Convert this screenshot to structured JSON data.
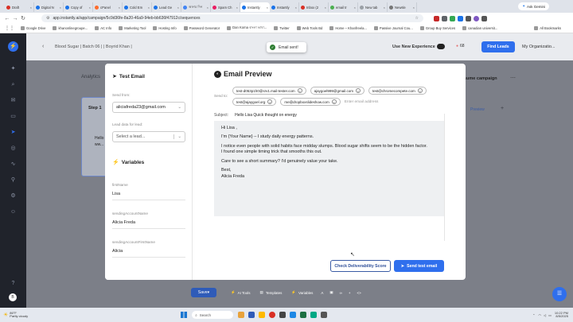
{
  "browser": {
    "tabs": [
      {
        "label": "Draft",
        "color": "#d93025"
      },
      {
        "label": "Digital N",
        "color": "#1a73e8"
      },
      {
        "label": "Copy of",
        "color": "#1a73e8"
      },
      {
        "label": "cPanel",
        "color": "#ff6c2c"
      },
      {
        "label": "Cold Em",
        "color": "#1a73e8"
      },
      {
        "label": "Lead Ge",
        "color": "#1a73e8"
      },
      {
        "label": "অফার দিন",
        "color": "#4285f4"
      },
      {
        "label": "Spam Ch",
        "color": "#e91e63"
      },
      {
        "label": "Instantly",
        "color": "#1a73e8",
        "active": true
      },
      {
        "label": "Instantly",
        "color": "#1a73e8"
      },
      {
        "label": "Inbox (2",
        "color": "#d93025"
      },
      {
        "label": "email tr",
        "color": "#4caf50"
      },
      {
        "label": "New tab",
        "color": "#9aa0a6"
      },
      {
        "label": "Newsle",
        "color": "#777"
      }
    ],
    "ask_gemini": "Ask Gemini",
    "url": "app.instantly.ai/app/campaign/5c9d36fe-8a20-46a9-94eb-bb636f47912c/sequences",
    "bookmarks": [
      "Google Drive",
      "khanonlinegroupe...",
      "AC Info",
      "Marketing Tool",
      "Hosting Info",
      "Password Generator",
      "Dan Koma বাংলা ভাষা...",
      "Twitter",
      "Web Tools Bd",
      "Home – Khanfreela...",
      "Passive Journal Cou...",
      "Group Buy Services",
      "canadian universit..."
    ],
    "all_bookmarks": "All Bookmarks"
  },
  "app": {
    "campaign_title": "Blood Sugar | Batch 06 | | Boyrid Khan |",
    "new_experience": "Use New Experience",
    "credits": "68",
    "find_leads": "Find Leads",
    "org": "My Organizatio...",
    "analytics": "Analytics",
    "step1": "Step 1",
    "step_preview": "Hello",
    "step_preview2": "ww...",
    "pause_campaign": "sume campaign",
    "preview_link": "Preview"
  },
  "toast": {
    "text": "Email sent!"
  },
  "modal": {
    "left": {
      "title": "Test Email",
      "send_from_label": "Send from:",
      "send_from_value": "aliciafreda23@gmail.com",
      "lead_data_label": "Lead data for lead:",
      "lead_placeholder": "Select a lead...",
      "variables_title": "Variables",
      "variables": [
        {
          "name": "firstName",
          "value": "Lisa"
        },
        {
          "name": "sendingAccountName",
          "value": "Alicia Freda"
        },
        {
          "name": "sendingAccountFirstName",
          "value": "Alicia"
        }
      ]
    },
    "right": {
      "title": "Email Preview",
      "send_to_label": "Send to:",
      "recipients": [
        "test-d053p1h0@srv1.mail-tester.com",
        "ajaygoel999@gmail.com",
        "test@chromecompete.com",
        "test@ajaygoel.org",
        "me@dropboxslideshow.com"
      ],
      "email_placeholder": "Enter email address",
      "subject_label": "Subject:",
      "subject_value": "Hello Lisa Quick thought on energy",
      "body": [
        "Hi Lisa ,",
        "I'm {Your Name} – I study daily energy patterns.",
        "I notice even people with solid habits face midday slumps. Blood sugar shifts seem to be the hidden factor.",
        "I found one simple timing trick that smooths this out.",
        "Care to see a short summary? I'd genuinely value your take.",
        "Best,",
        "Alicia Freda"
      ],
      "check_btn": "Check Deliverability Score",
      "send_btn": "Send test email"
    }
  },
  "toolbar": {
    "save": "Save",
    "ai_tools": "AI Tools",
    "templates": "Templates",
    "variables": "Variables"
  },
  "taskbar": {
    "weather_temp": "86°F",
    "weather_desc": "Partly cloudy",
    "search": "Search",
    "time": "10:22 PM",
    "date": "8/5/2025"
  }
}
